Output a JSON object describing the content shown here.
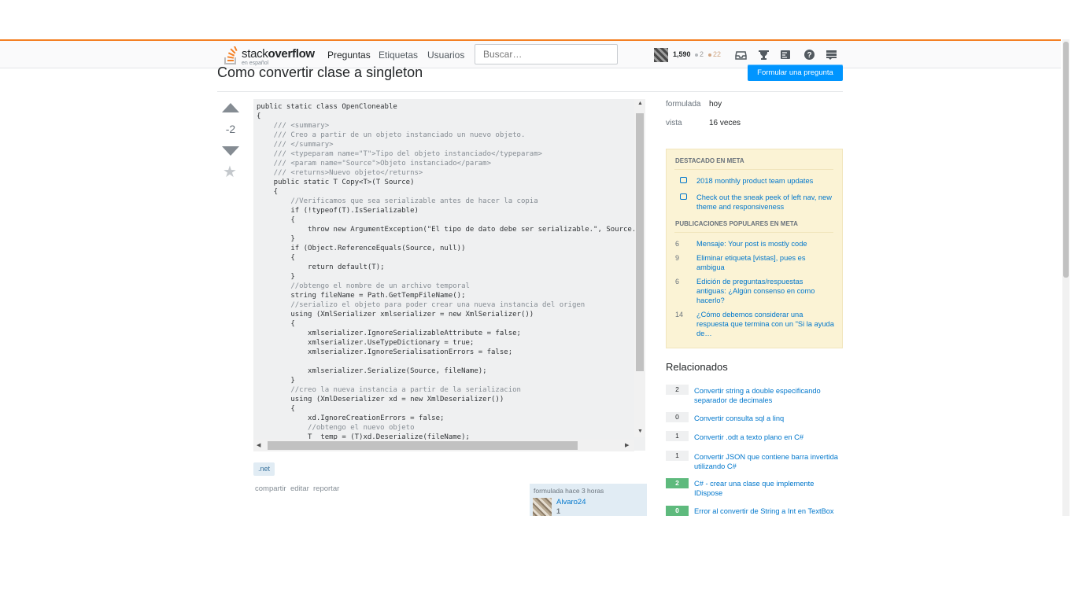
{
  "topbar": {
    "logo_text_1": "stack",
    "logo_text_2": "overflow",
    "logo_sub": "en español",
    "nav": [
      "Preguntas",
      "Etiquetas",
      "Usuarios"
    ],
    "search_placeholder": "Buscar…",
    "reputation": "1,590",
    "silver_badges": "2",
    "bronze_badges": "22",
    "icons": [
      "inbox-icon",
      "achievements-icon",
      "review-icon",
      "help-icon",
      "site-switcher-icon"
    ],
    "accent_color": "#f48024"
  },
  "question": {
    "title": "Como convertir clase a singleton",
    "ask_button": "Formular una pregunta",
    "score": "-2",
    "code_lines": [
      "public static class OpenCloneable",
      "{",
      "    /// <summary>",
      "    /// Creo a partir de un objeto instanciado un nuevo objeto.",
      "    /// </summary>",
      "    /// <typeparam name=\"T\">Tipo del objeto instanciado</typeparam>",
      "    /// <param name=\"Source\">Objeto instanciado</param>",
      "    /// <returns>Nuevo objeto</returns>",
      "    public static T Copy<T>(T Source)",
      "    {",
      "        //Verificamos que sea serializable antes de hacer la copia",
      "        if (!typeof(T).IsSerializable)",
      "        {",
      "            throw new ArgumentException(\"El tipo de dato debe ser serializable.\", Source.T",
      "        }",
      "        if (Object.ReferenceEquals(Source, null))",
      "        {",
      "            return default(T);",
      "        }",
      "        //obtengo el nombre de un archivo temporal",
      "        string fileName = Path.GetTempFileName();",
      "        //serializo el objeto para poder crear una nueva instancia del origen",
      "        using (XmlSerializer xmlserializer = new XmlSerializer())",
      "        {",
      "            xmlserializer.IgnoreSerializableAttribute = false;",
      "            xmlserializer.UseTypeDictionary = true;",
      "            xmlserializer.IgnoreSerialisationErrors = false;",
      "",
      "            xmlserializer.Serialize(Source, fileName);",
      "        }",
      "        //creo la nueva instancia a partir de la serializacion",
      "        using (XmlDeserializer xd = new XmlDeserializer())",
      "        {",
      "            xd.IgnoreCreationErrors = false;",
      "            //obtengo el nuevo objeto",
      "            T  temp = (T)xd.Deserialize(fileName);"
    ],
    "tag": ".net",
    "post_menu": [
      "compartir",
      "editar",
      "reportar"
    ],
    "owner": {
      "time": "formulada hace 3 horas",
      "name": "Alvaro24",
      "rep": "1"
    }
  },
  "sidebar": {
    "meta": [
      {
        "label": "formulada",
        "value": "hoy"
      },
      {
        "label": "vista",
        "value": "16 veces"
      }
    ],
    "featured_header": "DESTACADO EN META",
    "featured": [
      "2018 monthly product team updates",
      "Check out the sneak peek of left nav, new theme and responsiveness"
    ],
    "popular_header": "PUBLICACIONES POPULARES EN META",
    "popular": [
      {
        "count": "6",
        "text": "Mensaje: Your post is mostly code"
      },
      {
        "count": "9",
        "text": "Eliminar etiqueta [vistas], pues es ambigua"
      },
      {
        "count": "6",
        "text": "Edición de preguntas/respuestas antiguas: ¿Algún consenso en como hacerlo?"
      },
      {
        "count": "14",
        "text": "¿Cómo debemos considerar una respuesta que termina con un \"Si la ayuda de…"
      }
    ],
    "related_header": "Relacionados",
    "related": [
      {
        "score": "2",
        "text": "Convertir string a double especificando separador de decimales",
        "accepted": false
      },
      {
        "score": "0",
        "text": "Convertir consulta sql a linq",
        "accepted": false
      },
      {
        "score": "1",
        "text": "Convertir .odt a texto plano en C#",
        "accepted": false
      },
      {
        "score": "1",
        "text": "Convertir JSON que contiene barra invertida utilizando C#",
        "accepted": false
      },
      {
        "score": "2",
        "text": "C# - crear una clase que implemente IDispose",
        "accepted": true
      },
      {
        "score": "0",
        "text": "Error al convertir de String a Int en TextBox",
        "accepted": true
      }
    ]
  }
}
